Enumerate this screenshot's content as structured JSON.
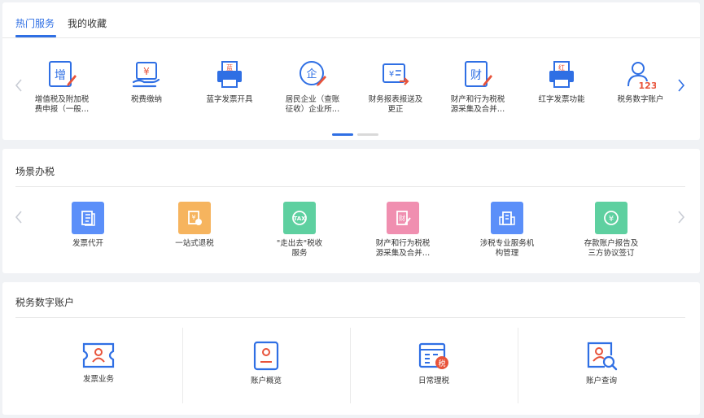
{
  "hot_services": {
    "tabs": [
      {
        "label": "热门服务"
      },
      {
        "label": "我的收藏"
      }
    ],
    "items": [
      {
        "label": "增值税及附加税\n费申报（一般…",
        "icon": "vat-declare-icon",
        "glyph": "增"
      },
      {
        "label": "税费缴纳",
        "icon": "tax-payment-icon",
        "glyph": "¥"
      },
      {
        "label": "蓝字发票开具",
        "icon": "blue-invoice-printer-icon",
        "glyph": "蓝"
      },
      {
        "label": "居民企业（查账\n征收）企业所…",
        "icon": "enterprise-income-icon",
        "glyph": "企"
      },
      {
        "label": "财务报表报送及\n更正",
        "icon": "financial-report-icon",
        "glyph": "¥"
      },
      {
        "label": "财产和行为税税\n源采集及合并…",
        "icon": "property-tax-icon",
        "glyph": "财"
      },
      {
        "label": "红字发票功能",
        "icon": "red-invoice-printer-icon",
        "glyph": "红"
      },
      {
        "label": "税务数字账户",
        "icon": "digital-account-user-icon",
        "glyph": "123"
      }
    ]
  },
  "scenarios": {
    "title": "场景办税",
    "items": [
      {
        "label": "发票代开",
        "color": "#5b8ff9",
        "icon": "invoice-proxy-icon"
      },
      {
        "label": "一站式退税",
        "color": "#f6b45e",
        "icon": "one-stop-refund-icon"
      },
      {
        "label": "\"走出去\"税收\n服务",
        "color": "#5ed0a0",
        "icon": "going-global-tax-icon"
      },
      {
        "label": "财产和行为税税\n源采集及合并…",
        "color": "#f08fb0",
        "icon": "property-tax-tile-icon"
      },
      {
        "label": "涉税专业服务机\n构管理",
        "color": "#5b8ff9",
        "icon": "tax-agency-building-icon"
      },
      {
        "label": "存款账户报告及\n三方协议签订",
        "color": "#5ed0a0",
        "icon": "deposit-account-icon"
      }
    ]
  },
  "digital_account": {
    "title": "税务数字账户",
    "items": [
      {
        "label": "发票业务",
        "icon": "invoice-business-icon"
      },
      {
        "label": "账户概览",
        "icon": "account-overview-icon"
      },
      {
        "label": "日常理税",
        "icon": "daily-tax-icon",
        "glyph": "税"
      },
      {
        "label": "账户查询",
        "icon": "account-query-icon"
      }
    ]
  },
  "colors": {
    "primary": "#2f6fe4",
    "accent_red": "#e8533a",
    "muted": "#c8ccd4"
  }
}
